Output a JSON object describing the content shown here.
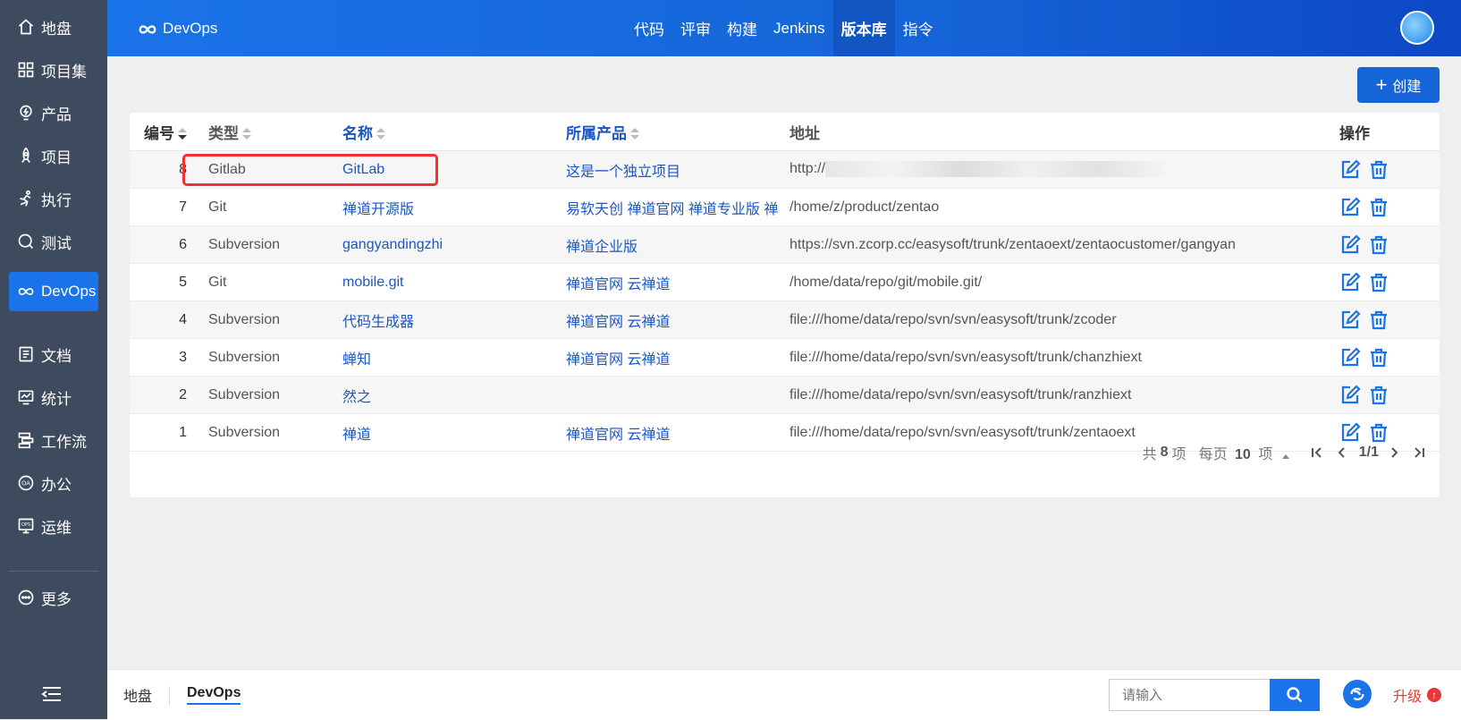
{
  "sidebar": {
    "items": [
      {
        "label": "地盘",
        "icon": "home-icon"
      },
      {
        "label": "项目集",
        "icon": "grid-icon"
      },
      {
        "label": "产品",
        "icon": "lightbulb-icon"
      },
      {
        "label": "项目",
        "icon": "rocket-icon"
      },
      {
        "label": "执行",
        "icon": "run-icon"
      },
      {
        "label": "测试",
        "icon": "magnifier-icon"
      },
      {
        "label": "DevOps",
        "icon": "infinity-icon",
        "active": true
      },
      {
        "label": "文档",
        "icon": "document-icon"
      },
      {
        "label": "统计",
        "icon": "monitor-chart-icon"
      },
      {
        "label": "工作流",
        "icon": "workflow-icon"
      },
      {
        "label": "办公",
        "icon": "oa-icon"
      },
      {
        "label": "运维",
        "icon": "ops-icon"
      },
      {
        "label": "更多",
        "icon": "more-icon"
      }
    ]
  },
  "header": {
    "brand": "DevOps",
    "nav": [
      "代码",
      "评审",
      "构建",
      "Jenkins",
      "版本库",
      "指令"
    ],
    "active_nav": "版本库",
    "accent": "#1a73e8"
  },
  "toolbar": {
    "create_label": "创建"
  },
  "table": {
    "columns": [
      "编号",
      "类型",
      "名称",
      "所属产品",
      "地址",
      "操作"
    ],
    "rows": [
      {
        "id": "8",
        "type": "Gitlab",
        "name": "GitLab",
        "product": "这是一个独立项目",
        "path": "http://"
      },
      {
        "id": "7",
        "type": "Git",
        "name": "禅道开源版",
        "product": "易软天创 禅道官网 禅道专业版 禅",
        "path": "/home/z/product/zentao"
      },
      {
        "id": "6",
        "type": "Subversion",
        "name": "gangyandingzhi",
        "product": "禅道企业版",
        "path": "https://svn.zcorp.cc/easysoft/trunk/zentaoext/zentaocustomer/gangyan"
      },
      {
        "id": "5",
        "type": "Git",
        "name": "mobile.git",
        "product": "禅道官网 云禅道",
        "path": "/home/data/repo/git/mobile.git/"
      },
      {
        "id": "4",
        "type": "Subversion",
        "name": "代码生成器",
        "product": "禅道官网 云禅道",
        "path": "file:///home/data/repo/svn/svn/easysoft/trunk/zcoder"
      },
      {
        "id": "3",
        "type": "Subversion",
        "name": "蝉知",
        "product": "禅道官网 云禅道",
        "path": "file:///home/data/repo/svn/svn/easysoft/trunk/chanzhiext"
      },
      {
        "id": "2",
        "type": "Subversion",
        "name": "然之",
        "product": "",
        "path": "file:///home/data/repo/svn/svn/easysoft/trunk/ranzhiext"
      },
      {
        "id": "1",
        "type": "Subversion",
        "name": "禅道",
        "product": "禅道官网 云禅道",
        "path": "file:///home/data/repo/svn/svn/easysoft/trunk/zentaoext"
      }
    ]
  },
  "pager": {
    "total_prefix": "共",
    "total": "8",
    "total_suffix": "项",
    "per_page_prefix": "每页",
    "per_page": "10",
    "per_page_suffix": "项",
    "page": "1/1"
  },
  "footer": {
    "crumbs": [
      "地盘",
      "DevOps"
    ],
    "search_placeholder": "请输入",
    "upgrade_label": "升级"
  }
}
